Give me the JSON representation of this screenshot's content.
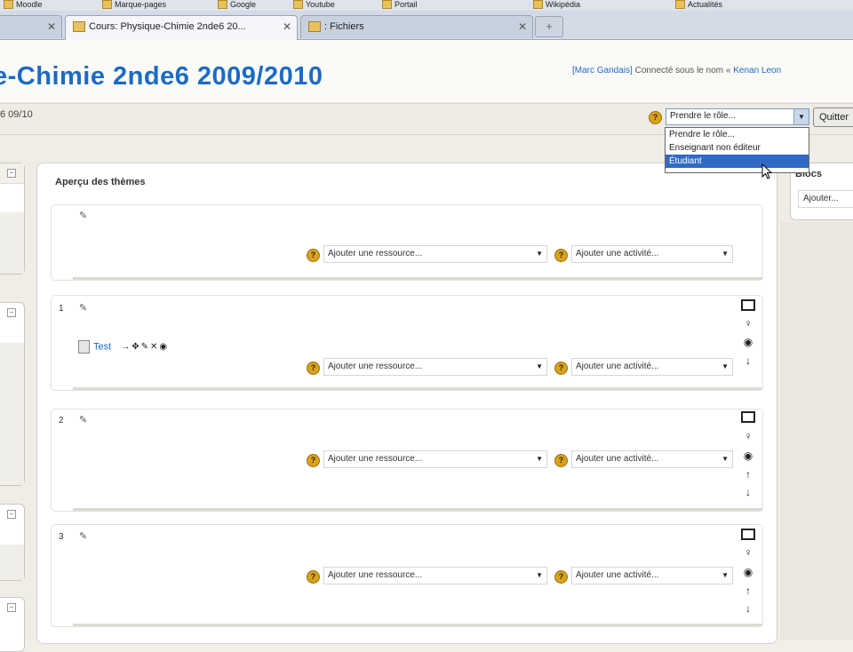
{
  "browser": {
    "bookmarks": [
      "Moodle",
      "Marque-pages",
      "Google",
      "Youtube",
      "Portail",
      "Wikipédia",
      "Actualités"
    ],
    "tabs": [
      {
        "label": "Cours: Physique-Chimie 2nde6 20...",
        "active": true
      },
      {
        "label": ": Fichiers",
        "active": false
      }
    ],
    "new_tab_label": "+"
  },
  "header": {
    "course_title": "e-Chimie 2nde6 2009/2010",
    "login_user": "[Marc Gandais]",
    "login_text": " Connecté sous le nom « ",
    "login_name": "Kenan Leon"
  },
  "navbar": {
    "breadcrumb": "6 09/10",
    "role_select_value": "Prendre le rôle...",
    "quit_button": "Quitter",
    "role_options": [
      "Prendre le rôle...",
      "Enseignant non éditeur",
      "Étudiant"
    ],
    "role_selected_index": 2
  },
  "main": {
    "overview_title": "Aperçu des thèmes",
    "resource_placeholder": "Ajouter une ressource...",
    "activity_placeholder": "Ajouter une activité...",
    "sections": [
      {
        "number": ""
      },
      {
        "number": "1",
        "resource": {
          "name": "Test"
        }
      },
      {
        "number": "2"
      },
      {
        "number": "3"
      }
    ]
  },
  "blocks": {
    "title": "Blocs",
    "add_select": "Ajouter..."
  },
  "icons": {
    "help": "help-icon",
    "edit": "edit-icon",
    "highlight": "lightbulb-icon",
    "visible": "eye-icon",
    "move_up": "arrow-up-icon",
    "move_down": "arrow-down-icon",
    "summary": "box-icon"
  },
  "colors": {
    "title_blue": "#1b6bc6",
    "help_gold": "#d8a21d",
    "selected_option": "#316ac5"
  }
}
